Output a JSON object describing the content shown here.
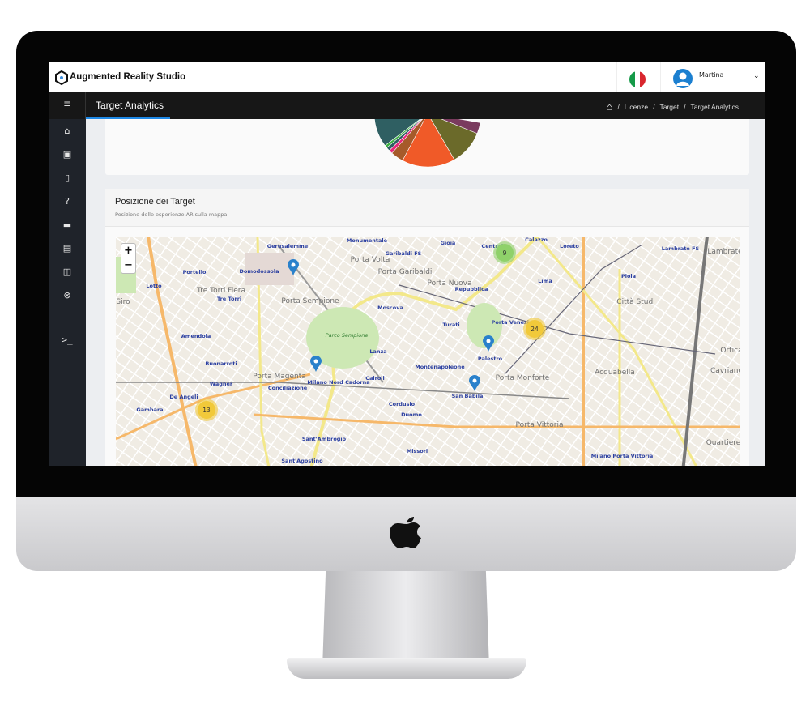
{
  "app": {
    "brand": "Augmented Reality Studio",
    "user": "Martina",
    "language_flag": "italy-flag",
    "colors": {
      "accent": "#1e88e5",
      "topbar": "#171717",
      "sidebar": "#1f232a"
    }
  },
  "header": {
    "page_title": "Target Analytics",
    "breadcrumb": [
      "Licenze",
      "Target",
      "Target Analytics"
    ]
  },
  "sidebar": {
    "items": [
      "home-icon",
      "image-icon",
      "mobile-icon",
      "help-icon",
      "book-icon",
      "clipboard-icon",
      "gallery-icon",
      "support-icon",
      "terminal-icon"
    ]
  },
  "pie": {
    "colors": [
      "#2f5f62",
      "#3cb043",
      "#2f5f62",
      "#e8287d",
      "#a65a2a",
      "#f05a28",
      "#6b6a2a",
      "#7a3b5e"
    ]
  },
  "map_card": {
    "title": "Posizione dei Target",
    "subtitle": "Posizione delle esperienze AR sulla mappa",
    "zoom_in": "+",
    "zoom_out": "−",
    "clusters": [
      "9",
      "24",
      "13"
    ],
    "labels": [
      "Gerusalemme",
      "Monumentale",
      "Porta Volta",
      "Garibaldi FS",
      "Porta Garibaldi",
      "Portello",
      "Domodossola",
      "Lotto",
      "Tre Torri Fiera",
      "Tre Torri",
      "Porta Sempione",
      "Moscova",
      "Siro",
      "Amendola",
      "Parco Sempione",
      "Lanza",
      "Buonarroti",
      "Porta Magenta",
      "Wagner",
      "Milano Nord Cadorna",
      "Cairoli",
      "Conciliazione",
      "De Angeli",
      "Cordusio",
      "Gambara",
      "Duomo",
      "Sant'Ambrogio",
      "Missori",
      "Sant'Agostino",
      "Gioia",
      "Centrale",
      "Calazzo",
      "Loreto",
      "Lambrate FS",
      "Lambrate",
      "Piola",
      "Porta Nuova",
      "Repubblica",
      "Lima",
      "Città Studi",
      "Turati",
      "Porta Venezia",
      "Palestro",
      "Montenapoleone",
      "Acquabella",
      "Porta Monforte",
      "Cavriano",
      "Ortica",
      "San Babila",
      "Porta Vittoria",
      "Quartiere",
      "Milano Porta Vittoria"
    ]
  }
}
